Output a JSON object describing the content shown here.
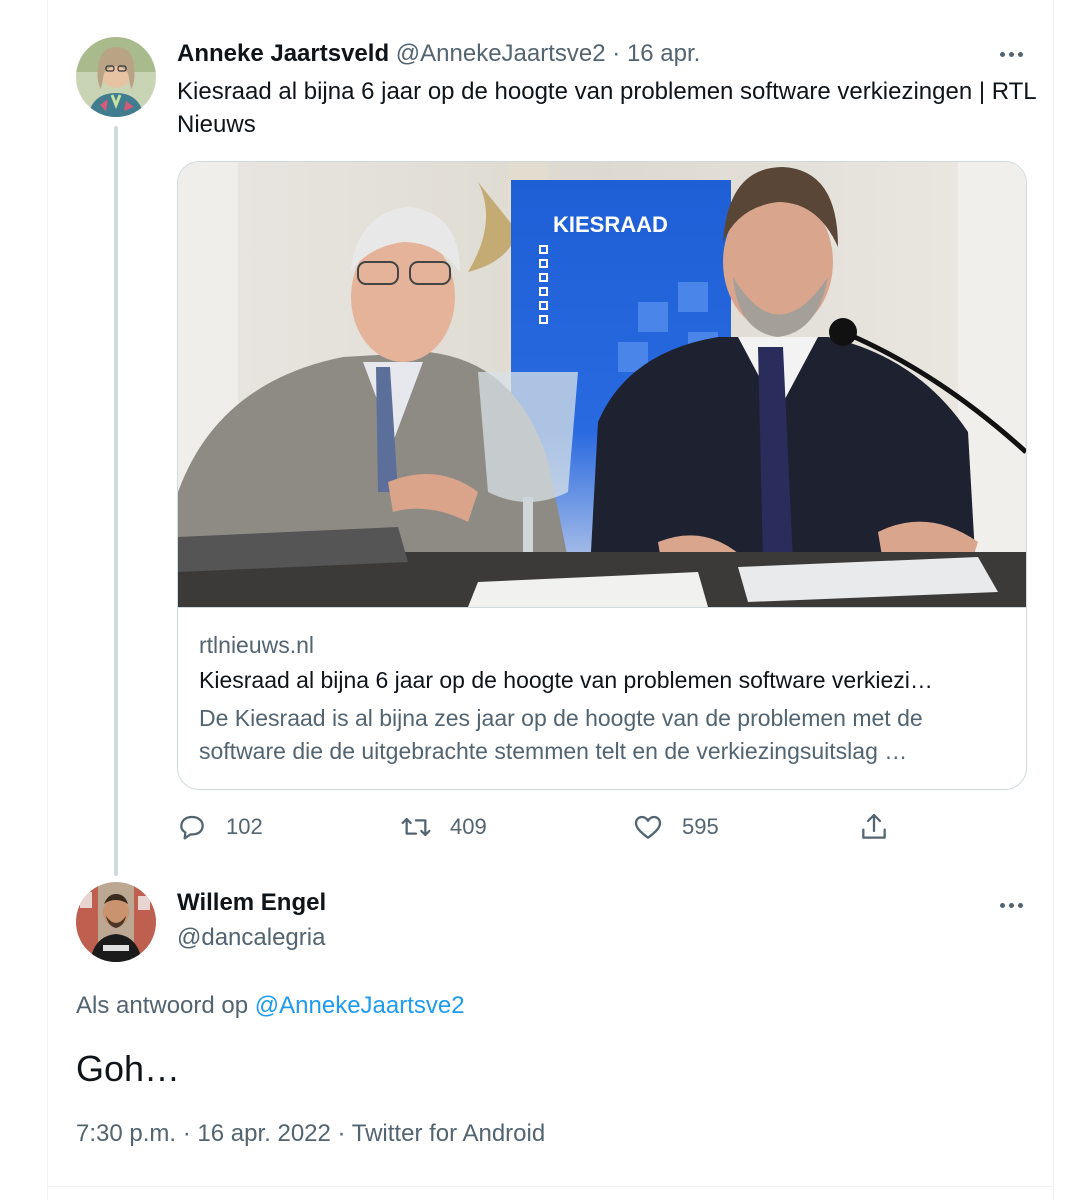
{
  "thread": {
    "tweet1": {
      "display_name": "Anneke Jaartsveld",
      "handle": "@AnnekeJaartsve2",
      "separator": "·",
      "date": "16 apr.",
      "text": "Kiesraad al bijna 6 jaar op de hoogte van problemen software verkiezingen | RTL Nieuws",
      "avatar_icon": "avatar-woman-icon",
      "card": {
        "image_text": "KIESRAAD",
        "domain": "rtlnieuws.nl",
        "title": "Kiesraad al bijna 6 jaar op de hoogte van problemen software verkiezi…",
        "description": "De Kiesraad is al bijna zes jaar op de hoogte van de problemen met de software die de uitgebrachte stemmen telt en de verkiezingsuitslag …"
      },
      "actions": {
        "replies": "102",
        "retweets": "409",
        "likes": "595"
      }
    },
    "tweet2": {
      "display_name": "Willem Engel",
      "handle": "@dancalegria",
      "reply_prefix": "Als antwoord op",
      "reply_to": "@AnnekeJaartsve2",
      "text": "Goh…",
      "time": "7:30 p.m.",
      "separator": "·",
      "date": "16 apr. 2022",
      "source": "Twitter for Android",
      "avatar_icon": "avatar-man-icon"
    }
  },
  "colors": {
    "text_primary": "#0f1419",
    "text_secondary": "#536471",
    "link": "#1d9bf0",
    "border": "#cfd9de",
    "thread_line": "#cfd9de",
    "kiesraad_blue": "#1f5fd6"
  }
}
